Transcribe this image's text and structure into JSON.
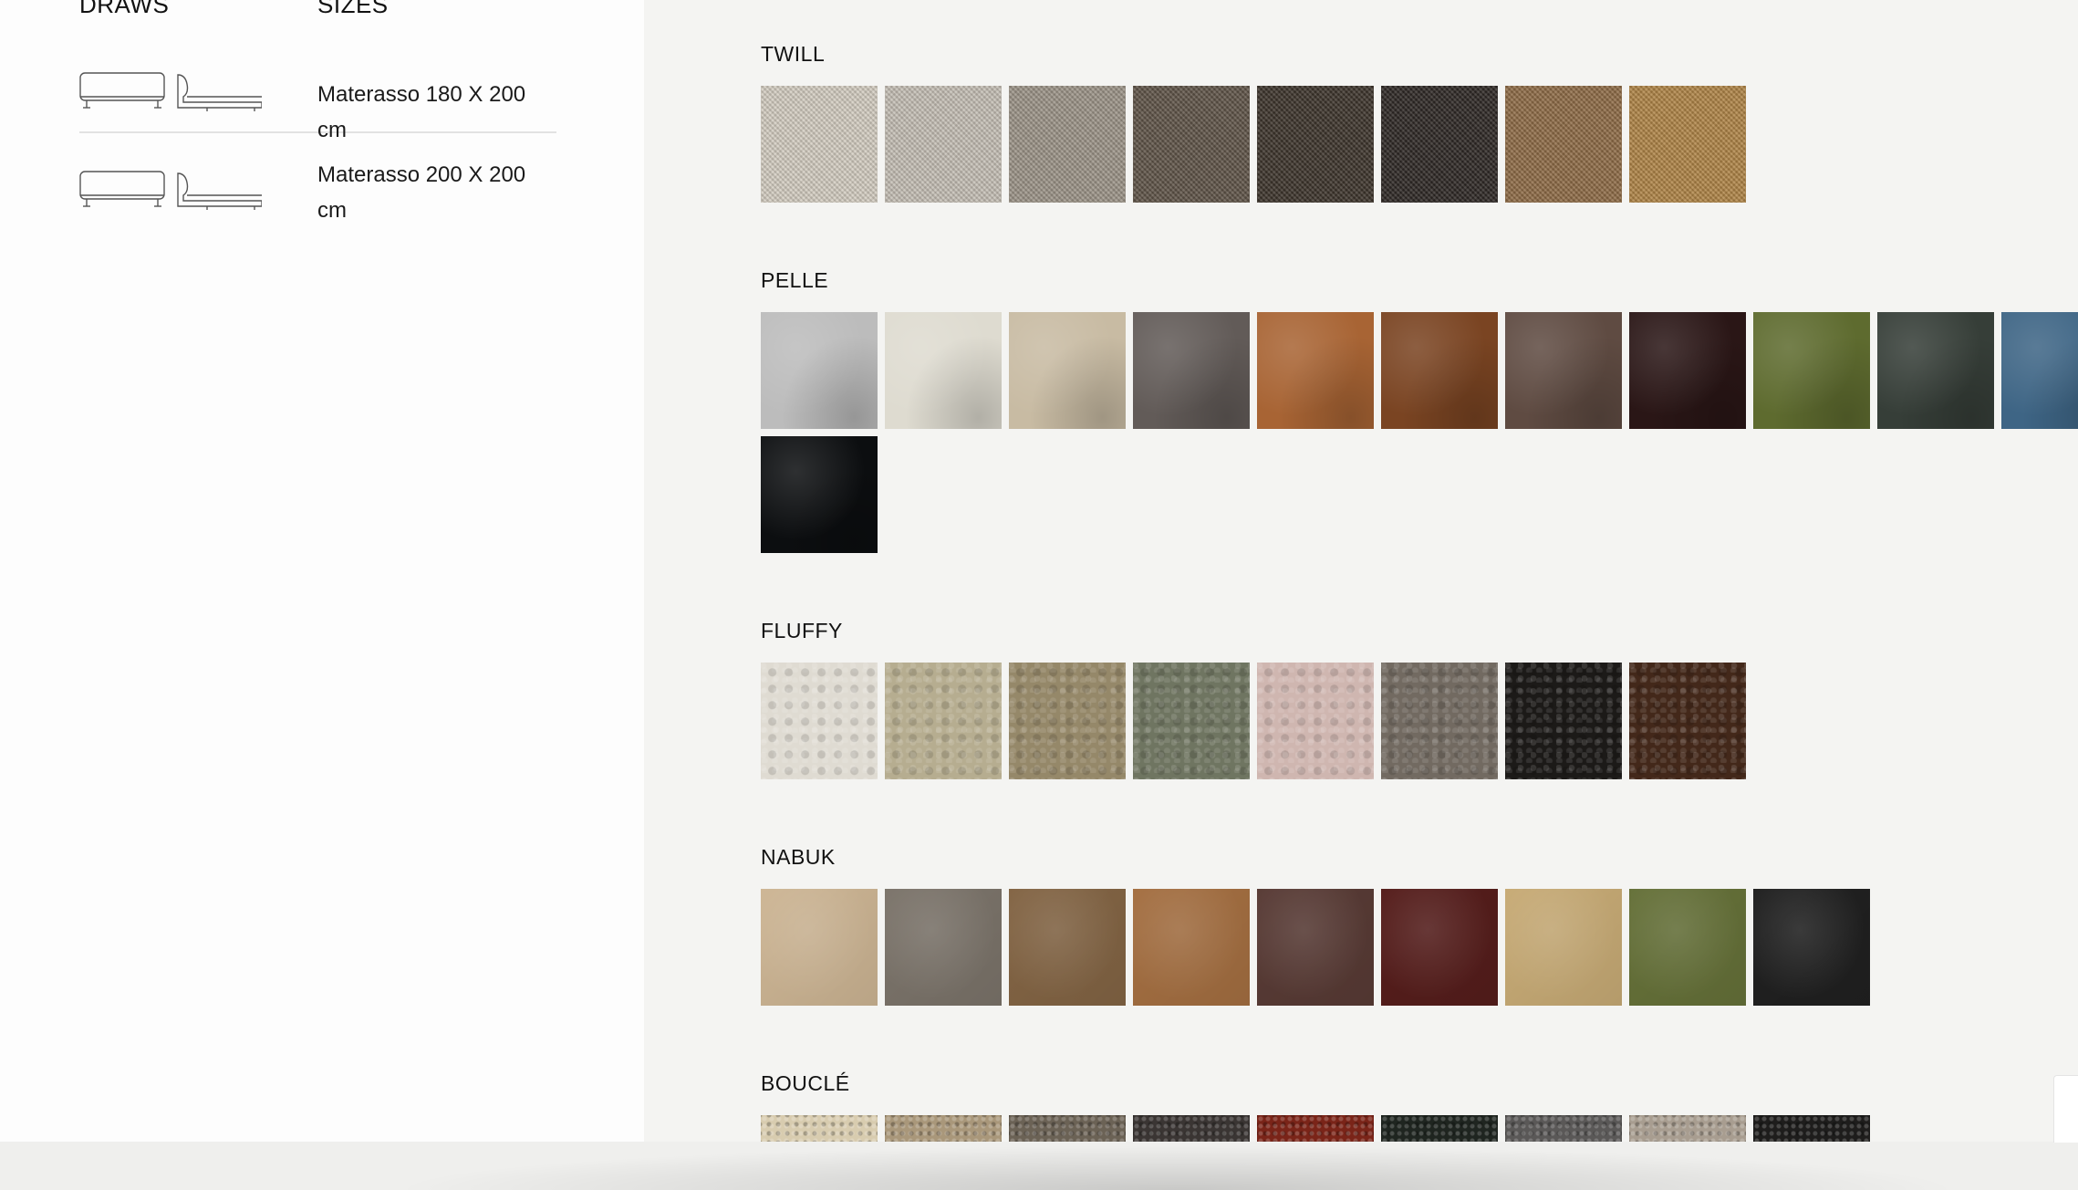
{
  "left_panel": {
    "headers": {
      "draws": "DRAWS",
      "sizes": "SIZES"
    },
    "sizes": [
      {
        "label": "Materasso 180 X 200 cm",
        "icon": "bed-drawing-icon"
      },
      {
        "label": "Materasso 200 X 200 cm",
        "icon": "bed-drawing-icon"
      }
    ]
  },
  "materials": [
    {
      "name": "TWILL",
      "texture": "weave",
      "swatches": [
        "#d4cdc1",
        "#c5bfb5",
        "#9c9488",
        "#5f5448",
        "#3d342b",
        "#2e2825",
        "#8e6b46",
        "#b08447"
      ]
    },
    {
      "name": "PELLE",
      "texture": "leather",
      "swatches": [
        "#bcbcbc",
        "#dedbd0",
        "#c8bba3",
        "#625b58",
        "#a86434",
        "#7a4422",
        "#5f4b42",
        "#2a1616",
        "#5e6b2f",
        "#363e38",
        "#3e6585",
        "#0c0e10"
      ]
    },
    {
      "name": "FLUFFY",
      "texture": "fluffy",
      "swatches": [
        "#dfdbd2",
        "#b6ad90",
        "#958869",
        "#6f7561",
        "#cfb6b0",
        "#726a61",
        "#1c1a18",
        "#43281a"
      ]
    },
    {
      "name": "NABUK",
      "texture": "nabuk",
      "swatches": [
        "#d8bf9c",
        "#827a70",
        "#8a6a48",
        "#ad7545",
        "#5d3e38",
        "#5a1f1d",
        "#d2b47c",
        "#6b773c",
        "#222222"
      ]
    },
    {
      "name": "BOUCLÉ",
      "texture": "boucle",
      "swatches": [
        "#d8ccaf",
        "#a9977a",
        "#6b6255",
        "#3a3533",
        "#7a2418",
        "#1f2520",
        "#5a5857",
        "#a89d90",
        "#1e1d1c"
      ]
    }
  ]
}
